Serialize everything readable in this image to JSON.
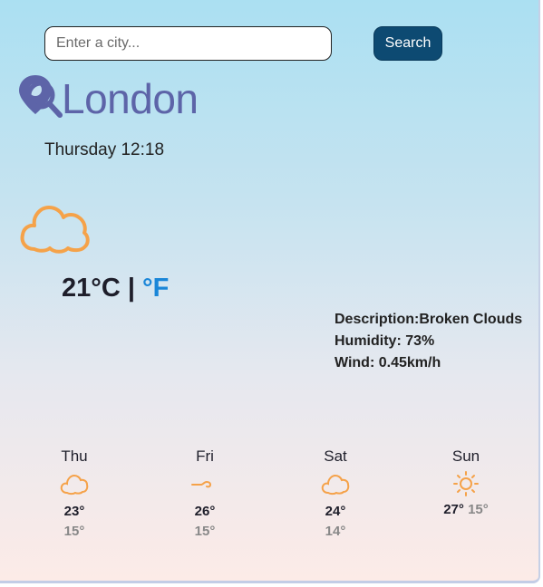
{
  "search": {
    "placeholder": "Enter a city...",
    "button_label": "Search"
  },
  "location": {
    "city": "London",
    "datetime": "Thursday 12:18"
  },
  "current": {
    "temperature": "21",
    "unit_celsius": "°C",
    "separator": " | ",
    "unit_fahrenheit": "°F",
    "icon": "broken-clouds-icon",
    "description_label": "Description:",
    "description": "Broken Clouds",
    "humidity_label": "Humidity: ",
    "humidity": "73%",
    "wind_label": "Wind: ",
    "wind": "0.45km/h"
  },
  "forecast": [
    {
      "day": "Thu",
      "icon": "cloud-icon",
      "max": "23°",
      "min": "15°"
    },
    {
      "day": "Fri",
      "icon": "wind-icon",
      "max": "26°",
      "min": "15°"
    },
    {
      "day": "Sat",
      "icon": "cloud-icon",
      "max": "24°",
      "min": "14°"
    },
    {
      "day": "Sun",
      "icon": "sun-icon",
      "max": "27°",
      "min": "15°"
    }
  ],
  "colors": {
    "accent": "#5d64a8",
    "icon_orange": "#f5a249",
    "button": "#0d4a72",
    "fahrenheit_link": "#1a86d8"
  }
}
